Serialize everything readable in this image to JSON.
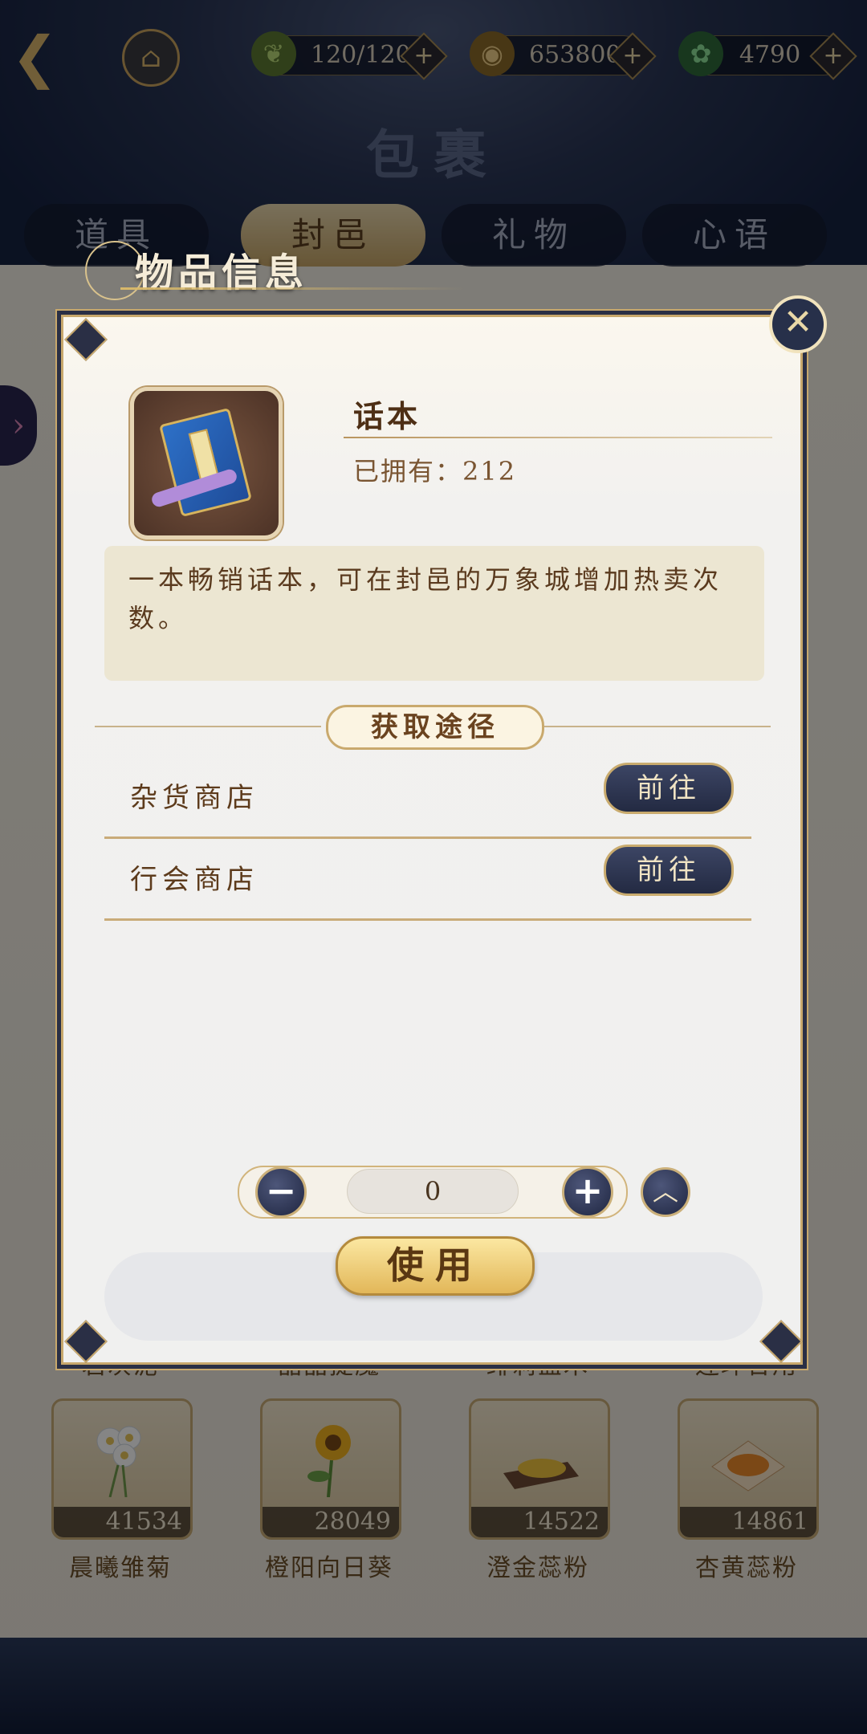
{
  "topbar": {
    "stamina": "120/120",
    "coins": "6538000",
    "jade": "4790"
  },
  "page_title": "包裹",
  "tabs": [
    {
      "label": "道具",
      "active": false
    },
    {
      "label": "封邑",
      "active": true
    },
    {
      "label": "礼物",
      "active": false
    },
    {
      "label": "心语",
      "active": false
    }
  ],
  "background_grid": {
    "partial_names": [
      "岩灰泥",
      "晶晶提魔",
      "绯莉盐木",
      "连环合用"
    ],
    "items": [
      {
        "name": "晨曦雏菊",
        "count": "41534"
      },
      {
        "name": "橙阳向日葵",
        "count": "28049"
      },
      {
        "name": "澄金蕊粉",
        "count": "14522"
      },
      {
        "name": "杏黄蕊粉",
        "count": "14861"
      }
    ]
  },
  "modal": {
    "title": "物品信息",
    "item_name": "话本",
    "owned_label": "已拥有：212",
    "description": "一本畅销话本，可在封邑的万象城增加热卖次数。",
    "source_title": "获取途径",
    "sources": [
      {
        "name": "杂货商店",
        "button": "前往"
      },
      {
        "name": "行会商店",
        "button": "前往"
      }
    ],
    "quantity": "0",
    "use_label": "使用"
  },
  "icons": {
    "back": "back-arrow-icon",
    "home": "home-icon",
    "stamina": "leaf-icon",
    "coins": "coin-icon",
    "jade": "jade-icon",
    "close": "close-icon"
  }
}
